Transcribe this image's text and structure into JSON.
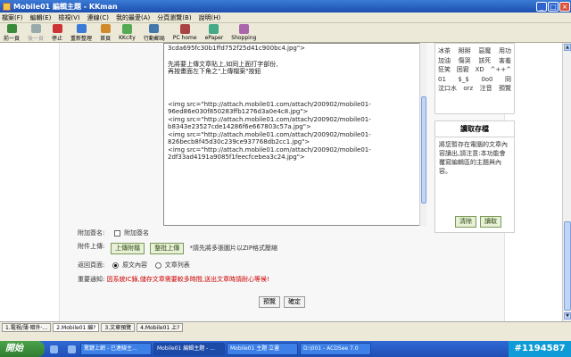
{
  "window": {
    "title": "Mobile01 編輯主題 - KKman"
  },
  "menu": [
    "檔案(F)",
    "編輯(E)",
    "檢視(V)",
    "連線(C)",
    "我的最愛(A)",
    "分頁瀏覽(B)",
    "說明(H)"
  ],
  "toolbar": [
    {
      "label": "前一頁",
      "icon": "back-icon",
      "color": "#3a8a3a",
      "disabled": false
    },
    {
      "label": "後一頁",
      "icon": "forward-icon",
      "color": "#9aa",
      "disabled": true
    },
    {
      "label": "停止",
      "icon": "stop-icon",
      "color": "#c33",
      "disabled": false
    },
    {
      "label": "重新整理",
      "icon": "refresh-icon",
      "color": "#3a7bd5",
      "disabled": false
    },
    {
      "label": "首頁",
      "icon": "home-icon",
      "color": "#d08a2a",
      "disabled": false
    },
    {
      "label": "KKcity",
      "icon": "kkcity-icon",
      "color": "#5a5",
      "disabled": false
    },
    {
      "label": "行動郵局",
      "icon": "mail-icon",
      "color": "#47a",
      "disabled": false
    },
    {
      "label": "PC home",
      "icon": "pchome-icon",
      "color": "#a44",
      "disabled": false
    },
    {
      "label": "ePaper",
      "icon": "epaper-icon",
      "color": "#4a8",
      "disabled": false
    },
    {
      "label": "Shopping",
      "icon": "shopping-icon",
      "color": "#a6a",
      "disabled": false
    }
  ],
  "editor": {
    "lines_top": [
      "3cda695fc30b1ffd752f25d41c900bc4.jpg\">"
    ],
    "lines_middle": [
      "先將要上傳文章貼上,如同上面打字部份,",
      "再按畫面左下角之\"上傳檔案\"按鈕"
    ],
    "lines_bottom": [
      "<img src=\"http://attach.mobile01.com/attach/200902/mobile01-",
      "96ed86e030f850283ffb1276d3a0e4c8.jpg\">",
      "<img src=\"http://attach.mobile01.com/attach/200902/mobile01-",
      "b8343e23527cde14286f6e667803c57a.jpg\">",
      "<img src=\"http://attach.mobile01.com/attach/200902/mobile01-",
      "826becb8f45d30c239ce937768db2cc1.jpg\">",
      "<img src=\"http://attach.mobile01.com/attach/200902/mobile01-",
      "2df33ad4191a9085f1feecfcebea3c24.jpg\">"
    ]
  },
  "emoji": [
    [
      "冰茶",
      "掰掰",
      "惡魔",
      "用功"
    ],
    [
      "加油",
      "傷哭",
      "該死",
      "害羞"
    ],
    [
      "狂笑",
      "困窘",
      "XD",
      "^++^"
    ],
    [
      "01",
      "$_$",
      "0o0",
      "冏"
    ],
    [
      "沈口水",
      "orz",
      "注音",
      "預覽"
    ]
  ],
  "save_box": {
    "title": "讀取存檔",
    "text": "將您暫存在電腦的文章內容讀出,請注意:本功能會覆寫編輯區的主題與內容。",
    "clear": "清除",
    "load": "讀取"
  },
  "form": {
    "signature_label": "附加簽名:",
    "signature_option": "附加簽名",
    "attachment_label": "附件上傳:",
    "upload_file": "上傳附檔",
    "batch_upload": "整批上傳",
    "upload_hint": "*請先將多張圖片以ZIP格式壓縮",
    "return_label": "返回頁面:",
    "return_content": "原文內容",
    "return_list": "文章列表",
    "notice_label": "重要通知:",
    "notice_text": "因系統IC錄,儲存文章需要較多時間,送出文章時請耐心等候!",
    "preview": "預覽",
    "submit": "確定"
  },
  "status_tabs": [
    "1.電視/薄·暗外·...",
    "2.Mobile01 編?",
    "3.文章預覽",
    "4.Mobile01 上?"
  ],
  "taskbar": {
    "start": "開始",
    "tasks": [
      "驚鍵上網 - 已連線主...",
      "Mobile01 編輯主題 - ...",
      "Mobile01 主題 立畫",
      "D:\\001 - ACDSee 7.0"
    ],
    "tray": "#1194587"
  }
}
